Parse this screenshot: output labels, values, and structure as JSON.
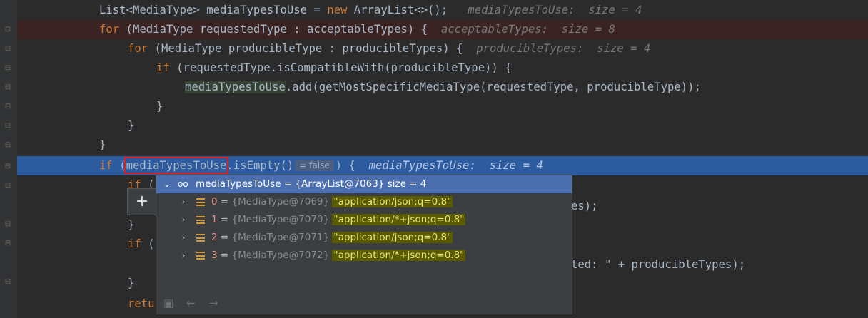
{
  "code": {
    "line1": {
      "decl": "List<MediaType> mediaTypesToUse = ",
      "kw": "new",
      "rest": " ArrayList<>();",
      "hint": "mediaTypesToUse:  size = 4"
    },
    "line2": {
      "kw": "for",
      "rest": " (MediaType requestedType : acceptableTypes) {",
      "hint": "acceptableTypes:  size = 8"
    },
    "line3": {
      "kw": "for",
      "rest": " (MediaType producibleType : producibleTypes) {",
      "hint": "producibleTypes:  size = 4"
    },
    "line4": {
      "kw": "if",
      "rest": " (requestedType.isCompatibleWith(producibleType)) {"
    },
    "line5": {
      "var": "mediaTypesToUse",
      "rest": ".add(getMostSpecificMediaType(requestedType, producibleType));"
    },
    "line6": "}",
    "line7": "}",
    "line8": "}",
    "line9": {
      "kw": "if",
      "open": " (",
      "var": "mediaTypesToUse",
      "call": ".isEmpty()",
      "inlay": "= false",
      "close": ") {",
      "hint": "mediaTypesToUse:  size = 4"
    },
    "line10": {
      "kw": "if",
      "rest": " ("
    },
    "line11_tail": "es);",
    "line12": "}",
    "line13": {
      "kw": "if",
      "rest": " ("
    },
    "line14_tail": "ted: \" + producibleTypes);",
    "line15": "}",
    "line16": {
      "kw": "retu"
    }
  },
  "popup": {
    "header": {
      "name": "mediaTypesToUse",
      "value": " = {ArrayList@7063}  size = 4"
    },
    "items": [
      {
        "index": "0",
        "eq": " = ",
        "ref": "{MediaType@7069}",
        "value": "\"application/json;q=0.8\""
      },
      {
        "index": "1",
        "eq": " = ",
        "ref": "{MediaType@7070}",
        "value": "\"application/*+json;q=0.8\""
      },
      {
        "index": "2",
        "eq": " = ",
        "ref": "{MediaType@7071}",
        "value": "\"application/json;q=0.8\""
      },
      {
        "index": "3",
        "eq": " = ",
        "ref": "{MediaType@7072}",
        "value": "\"application/*+json;q=0.8\""
      }
    ],
    "add_label": "+"
  },
  "icons": {
    "expand": "chevron-down-icon",
    "collapsed": "chevron-right-icon",
    "watch": "glasses-icon",
    "field": "list-field-icon",
    "back": "arrow-left-icon",
    "forward": "arrow-right-icon",
    "folder": "folder-icon"
  },
  "colors": {
    "editor_bg": "#2b2b2b",
    "current_line": "#2d5b9f",
    "error_line": "#3a2323",
    "keyword": "#cc7832",
    "selection_box": "#e31e1e",
    "popup_header": "#4b6eaf",
    "string_highlight": "#5a5a00"
  }
}
